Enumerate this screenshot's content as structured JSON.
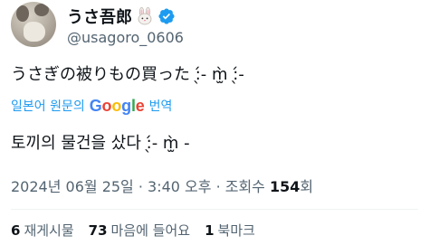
{
  "author": {
    "display_name": "うさ吾郎",
    "handle": "@usagoro_0606",
    "name_emoji_icon": "rabbit-face-icon",
    "verified_icon": "verified-badge-icon",
    "verified_color": "#1d9bf0"
  },
  "tweet": {
    "original_text": "うさぎの被りもの買った :̖́- m̫̀ :̖́-",
    "translation": {
      "label_prefix": "일본어 원문의",
      "provider": "Google",
      "label_suffix": "번역"
    },
    "translated_text": "토끼의 물건을 샀다 :̖́- m̫̀ -",
    "meta": {
      "date_time": "2024년 06월 25일 · 3:40 오후 · 조회수",
      "views": "154",
      "views_unit": "회"
    }
  },
  "stats": [
    {
      "count": "6",
      "label": "재게시물"
    },
    {
      "count": "73",
      "label": "마음에 들어요"
    },
    {
      "count": "1",
      "label": "북마크"
    }
  ],
  "colors": {
    "text_primary": "#0f1419",
    "text_secondary": "#536471",
    "link": "#1d9bf0",
    "google_blue": "#4285F4",
    "google_red": "#EA4335",
    "google_yellow": "#FBBC05",
    "google_green": "#34A853"
  }
}
